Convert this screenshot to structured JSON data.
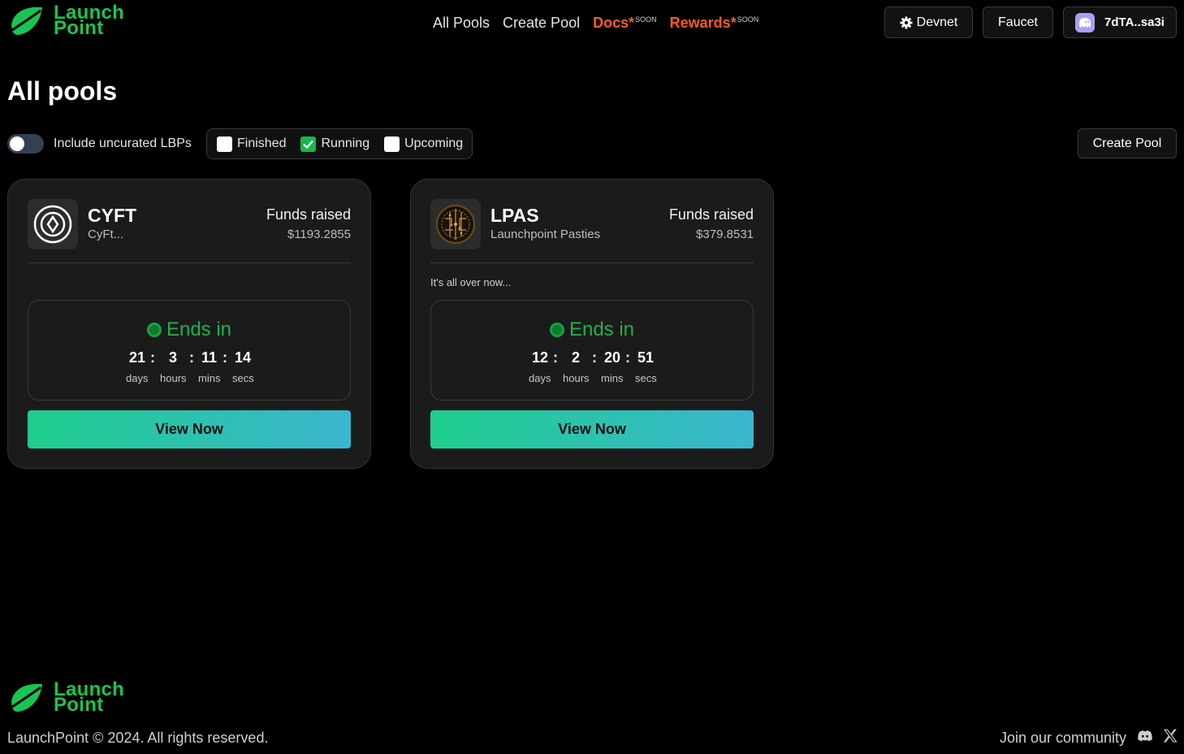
{
  "brand": {
    "line1": "Launch",
    "line2": "Point",
    "color": "#17c652"
  },
  "nav": {
    "all_pools": "All Pools",
    "create_pool": "Create Pool",
    "docs": "Docs",
    "rewards": "Rewards",
    "asterisk": "*",
    "soon": "SOON"
  },
  "header_buttons": {
    "devnet": "Devnet",
    "faucet": "Faucet",
    "wallet": "7dTA..sa3i"
  },
  "page": {
    "title": "All pools"
  },
  "filters": {
    "toggle_label": "Include uncurated LBPs",
    "toggle_on": false,
    "options": [
      {
        "label": "Finished",
        "checked": false
      },
      {
        "label": "Running",
        "checked": true
      },
      {
        "label": "Upcoming",
        "checked": false
      }
    ],
    "create_button": "Create Pool"
  },
  "pools": [
    {
      "symbol": "CYFT",
      "name": "CyFt...",
      "funds_label": "Funds raised",
      "funds_value": "$1193.2855",
      "description": "",
      "ends_label": "Ends in",
      "countdown": {
        "days": "21",
        "hours": "3",
        "mins": "11",
        "secs": "14"
      },
      "button": "View Now",
      "icon": "cyft-logo-icon"
    },
    {
      "symbol": "LPAS",
      "name": "Launchpoint Pasties",
      "funds_label": "Funds raised",
      "funds_value": "$379.8531",
      "description": "It's all over now...",
      "ends_label": "Ends in",
      "countdown": {
        "days": "12",
        "hours": "2",
        "mins": "20",
        "secs": "51"
      },
      "button": "View Now",
      "icon": "lpas-logo-icon"
    }
  ],
  "countdown_units": {
    "days": "days",
    "hours": "hours",
    "mins": "mins",
    "secs": "secs"
  },
  "footer": {
    "copyright": "LaunchPoint © 2024. All rights reserved.",
    "join": "Join our community"
  },
  "colors": {
    "accent_green": "#17c652",
    "hot_orange": "#ff5c1f",
    "button_gradient_start": "#1fce8e",
    "button_gradient_end": "#3bb6cf"
  }
}
